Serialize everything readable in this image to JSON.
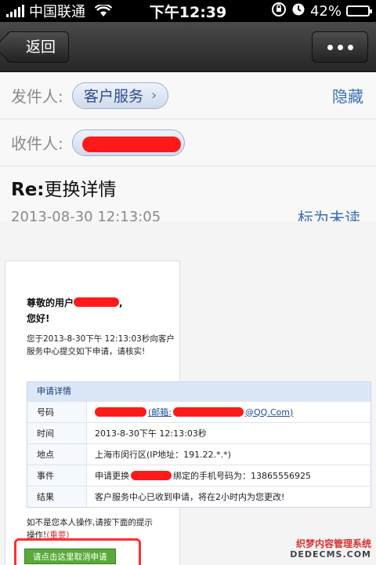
{
  "status_bar": {
    "carrier": "中国联通",
    "time": "下午12:39",
    "battery": "42%",
    "battery_level": 0.42
  },
  "nav": {
    "back_label": "返回"
  },
  "header": {
    "from_label": "发件人:",
    "from_name": "客户服务",
    "hide_label": "隐藏",
    "to_label": "收件人:"
  },
  "subject": {
    "prefix": "Re:",
    "title": "更换详情",
    "date": "2013-08-30 12:13:05",
    "mark_unread": "标为未读"
  },
  "email": {
    "greeting_line1": "尊敬的用户",
    "greeting_comma": ",",
    "greeting_line2": "您好!",
    "intro": "您于2013-8-30下午 12:13:03秒向客户服务中心提交如下申请，请核实!",
    "details_heading": "申请详情",
    "rows": [
      {
        "key": "号码",
        "value": "(邮箱:",
        "suffix": "@QQ.Com)"
      },
      {
        "key": "时间",
        "value": "2013-8-30下午 12:13:03秒"
      },
      {
        "key": "地点",
        "value": "上海市闵行区(IP地址：191.22.*.*)"
      },
      {
        "key": "事件",
        "value": "申请更换",
        "suffix": "绑定的手机号码为：13865556925"
      },
      {
        "key": "结果",
        "value": "客户服务中心已收到申请，将在2小时内为您更改!"
      }
    ],
    "note_line1": "如不是您本人操作,请按下面的提示",
    "note_line2": "操作!",
    "note_important": "(重要)",
    "cancel_button": "请点击这里取消申请"
  },
  "watermark": {
    "line1": "织梦内容管理系统",
    "line2": "DEDECMS.COM"
  }
}
